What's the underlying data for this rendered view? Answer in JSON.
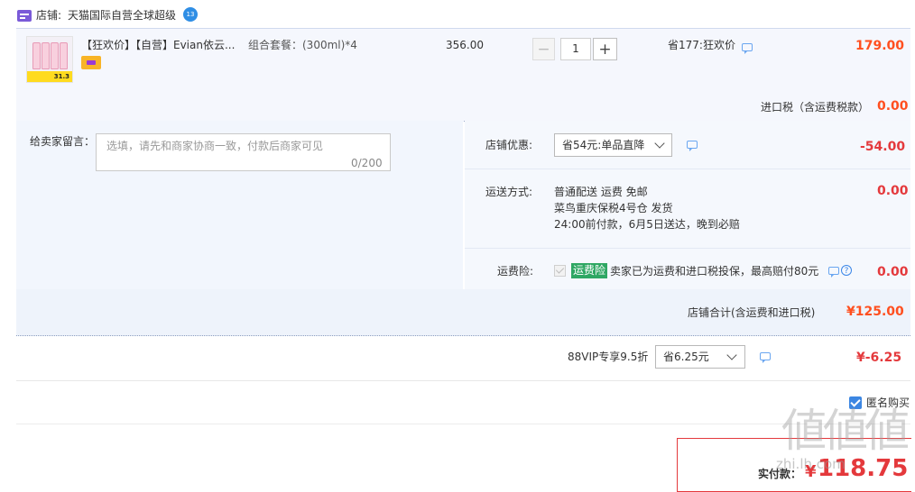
{
  "shop": {
    "label": "店铺:",
    "name": "天猫国际自营全球超级",
    "badge": "13"
  },
  "item": {
    "title": "【狂欢价】【自营】Evian依云...",
    "combo": "组合套餐：(300ml)*4",
    "unit_price": "356.00",
    "thumb_price": "31.3",
    "quantity": {
      "minus": "−",
      "value": "1",
      "plus": "+"
    },
    "discount": "省177:狂欢价",
    "subtotal": "179.00",
    "tax_label": "进口税（含运费税款）",
    "tax_value": "0.00"
  },
  "message": {
    "label": "给卖家留言：",
    "placeholder": "选填，请先和商家协商一致，付款后商家可见",
    "counter": "0/200"
  },
  "store_coupon": {
    "label": "店铺优惠:",
    "selected": "省54元:单品直降",
    "value": "-54.00"
  },
  "shipping": {
    "label": "运送方式:",
    "line1": "普通配送 运费 免邮",
    "line2": "菜鸟重庆保税4号仓 发货",
    "line3": "24:00前付款，6月5日送达，晚到必赔",
    "value": "0.00"
  },
  "insurance": {
    "label": "运费险:",
    "tag": "运费险",
    "desc": "卖家已为运费和进口税投保，最高赔付80元",
    "help": "?",
    "value": "0.00"
  },
  "store_total": {
    "label": "店铺合计(含运费和进口税)",
    "value": "¥125.00"
  },
  "vip": {
    "label": "88VIP专享9.5折",
    "selected": "省6.25元",
    "value": "¥-6.25"
  },
  "anonymous": {
    "label": "匿名购买"
  },
  "pay": {
    "label": "实付款：",
    "currency": "¥",
    "value": "118.75"
  },
  "watermark": {
    "main": "値値値",
    "sub": "zhi.lh.com"
  },
  "colors": {
    "price_orange": "#ff4f1f",
    "price_red": "#e4393c",
    "link_blue": "#3c86e2",
    "insurance_green": "#2fa763"
  }
}
